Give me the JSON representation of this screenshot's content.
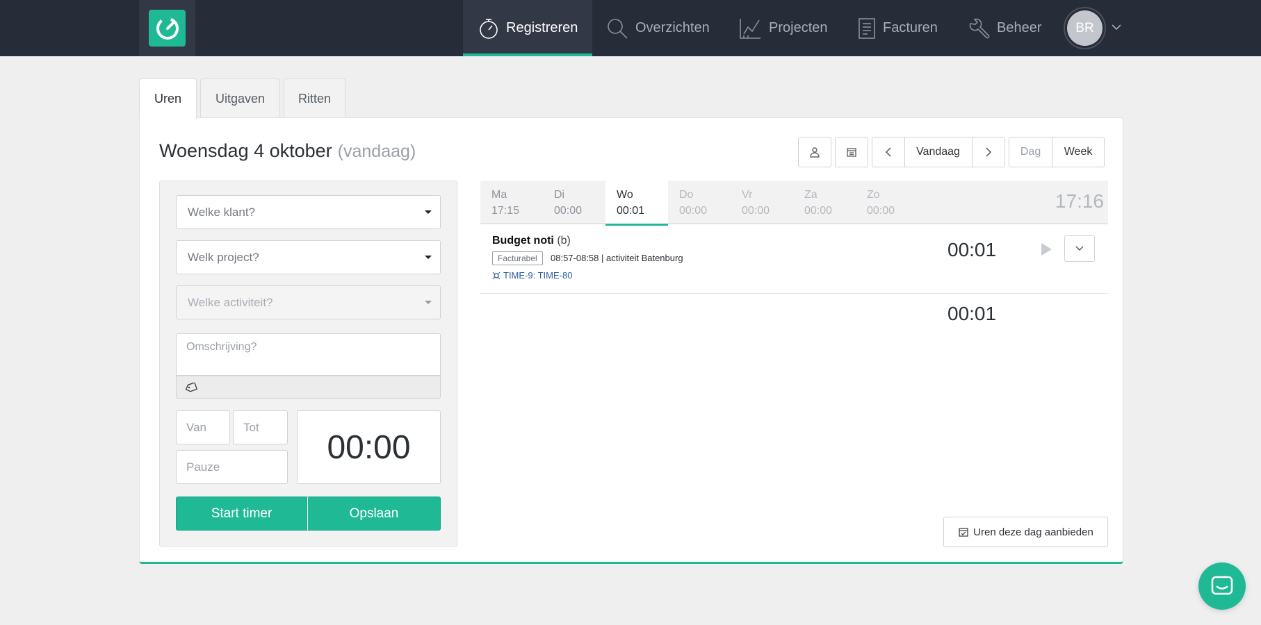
{
  "nav": {
    "items": [
      {
        "label": "Registreren",
        "icon": "stopwatch-icon"
      },
      {
        "label": "Overzichten",
        "icon": "search-icon"
      },
      {
        "label": "Projecten",
        "icon": "project-chart-icon"
      },
      {
        "label": "Facturen",
        "icon": "invoice-icon"
      },
      {
        "label": "Beheer",
        "icon": "wrench-icon"
      }
    ],
    "avatar": "BR"
  },
  "tabs": [
    "Uren",
    "Uitgaven",
    "Ritten"
  ],
  "header": {
    "title": "Woensdag 4 oktober",
    "subtitle": "(vandaag)"
  },
  "toolbar": {
    "today": "Vandaag",
    "day": "Dag",
    "week": "Week"
  },
  "form": {
    "client_placeholder": "Welke klant?",
    "project_placeholder": "Welk project?",
    "activity_placeholder": "Welke activiteit?",
    "description_placeholder": "Omschrijving?",
    "from_placeholder": "Van",
    "to_placeholder": "Tot",
    "pause_placeholder": "Pauze",
    "duration": "00:00",
    "start_timer": "Start timer",
    "save": "Opslaan"
  },
  "days": [
    {
      "name": "Ma",
      "time": "17:15"
    },
    {
      "name": "Di",
      "time": "00:00"
    },
    {
      "name": "Wo",
      "time": "00:01"
    },
    {
      "name": "Do",
      "time": "00:00"
    },
    {
      "name": "Vr",
      "time": "00:00"
    },
    {
      "name": "Za",
      "time": "00:00"
    },
    {
      "name": "Zo",
      "time": "00:00"
    }
  ],
  "week_total": "17:16",
  "entry": {
    "title": "Budget noti",
    "suffix": "(b)",
    "badge": "Facturabel",
    "meta": "08:57-08:58 | activiteit Batenburg",
    "link": "TIME-9: TIME-80",
    "time": "00:01"
  },
  "day_total": "00:01",
  "submit_label": "Uren deze dag aanbieden",
  "colors": {
    "accent": "#1fb996",
    "nav_bg": "#262c38"
  }
}
